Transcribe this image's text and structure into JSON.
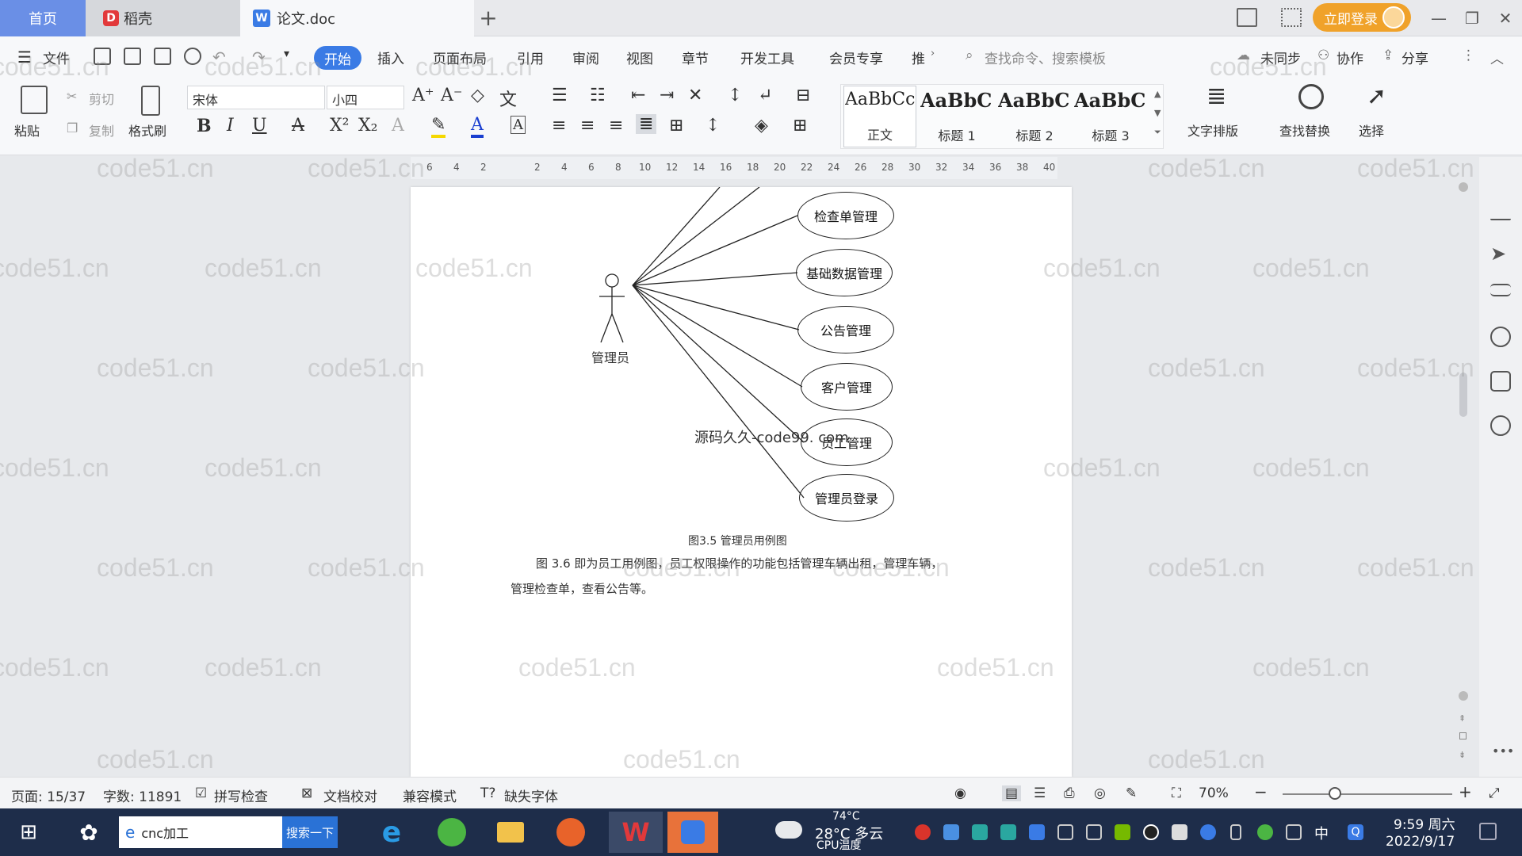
{
  "tabs": {
    "home": "首页",
    "docer": "稻壳",
    "document": "论文.doc",
    "add": "+"
  },
  "titlebar": {
    "login_label": "立即登录"
  },
  "menu": {
    "file": "文件",
    "items": [
      "开始",
      "插入",
      "页面布局",
      "引用",
      "审阅",
      "视图",
      "章节",
      "开发工具",
      "会员专享",
      "推"
    ],
    "search_cmd": "查找命令、搜索模板",
    "sync": "未同步",
    "collab": "协作",
    "share": "分享"
  },
  "ribbon": {
    "paste": "粘贴",
    "cut": "剪切",
    "copy": "复制",
    "format_painter": "格式刷",
    "font_name": "宋体",
    "font_size": "小四",
    "styles": [
      {
        "preview": "AaBbCcI",
        "name": "正文"
      },
      {
        "preview": "AaBbC",
        "name": "标题 1"
      },
      {
        "preview": "AaBbC",
        "name": "标题 2"
      },
      {
        "preview": "AaBbC",
        "name": "标题 3"
      }
    ],
    "text_layout": "文字排版",
    "find_replace": "查找替换",
    "select": "选择"
  },
  "ruler": {
    "numbers": [
      "6",
      "4",
      "2",
      "2",
      "4",
      "6",
      "8",
      "10",
      "12",
      "14",
      "16",
      "18",
      "20",
      "22",
      "24",
      "26",
      "28",
      "30",
      "32",
      "34",
      "36",
      "38",
      "40"
    ]
  },
  "document": {
    "actor_label": "管理员",
    "use_cases": [
      "检查单管理",
      "基础数据管理",
      "公告管理",
      "客户管理",
      "员工管理",
      "管理员登录"
    ],
    "overlay_text": "源码久久-code99. com",
    "caption": "图3.5  管理员用例图",
    "paragraph_line1": "图 3.6 即为员工用例图，员工权限操作的功能包括管理车辆出租，管理车辆，",
    "paragraph_line2": "管理检查单，查看公告等。"
  },
  "statusbar": {
    "page": "页面: 15/37",
    "words": "字数: 11891",
    "spellcheck": "拼写检查",
    "proofread": "文档校对",
    "compat": "兼容模式",
    "missing_font": "缺失字体",
    "zoom": "70%"
  },
  "taskbar": {
    "search_value": "cnc加工",
    "search_button": "搜索一下",
    "weather_temp": "28°C 多云",
    "cpu_temp": "74°C",
    "cpu_label": "CPU温度",
    "ime": "中",
    "time": "9:59 周六",
    "date": "2022/9/17"
  },
  "watermark": "code51.cn",
  "colors": {
    "accent": "#3a7be5",
    "login": "#f0a22a",
    "taskbar": "#1e2d4a"
  }
}
